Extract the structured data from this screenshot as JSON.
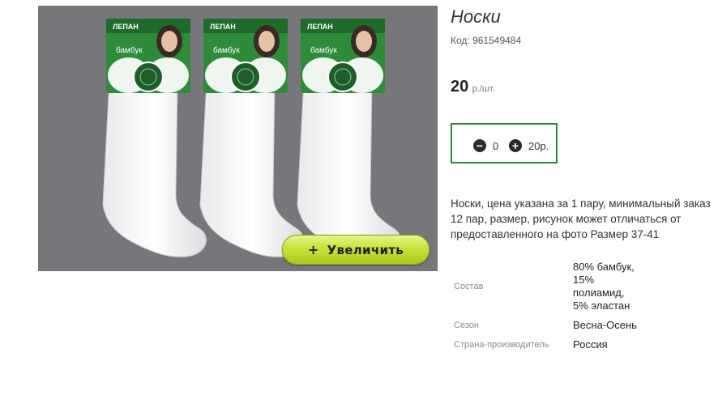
{
  "product": {
    "title": "Носки",
    "code": "Код: 961549484",
    "price": "20",
    "price_unit": "р./шт.",
    "description": "Носки, цена указана за 1 пару, минимальный заказ 12 пар, размер, рисунок может отличаться от предоставленного на фото Размер 37-41"
  },
  "image": {
    "zoom_icon": "+",
    "zoom_label": "Увеличить",
    "package_brand": "ЛЕПАН",
    "package_material": "бамбук"
  },
  "cart": {
    "minus_icon": "−",
    "plus_icon": "+",
    "quantity": "0",
    "sum": "20р."
  },
  "properties": [
    {
      "label": "Состав",
      "value": "80% бамбук, 15% полиамид, 5% эластан"
    },
    {
      "label": "Сезон",
      "value": "Весна-Осень"
    },
    {
      "label": "Страна-производитель",
      "value": "Россия"
    }
  ],
  "colors": {
    "photo_bg": "#77777b",
    "accent_border": "#2f8a2f",
    "zoom_button": "#c8e23a",
    "package_green": "#2e8b3a"
  }
}
